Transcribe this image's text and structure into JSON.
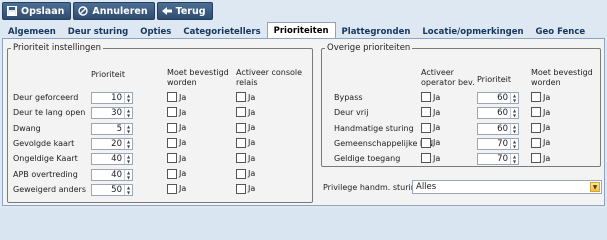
{
  "toolbar": {
    "save": {
      "label": "Opslaan",
      "icon": "save-icon"
    },
    "cancel": {
      "label": "Annuleren",
      "icon": "cancel-icon"
    },
    "back": {
      "label": "Terug",
      "icon": "back-arrow-icon"
    }
  },
  "tabs": [
    {
      "label": "Algemeen"
    },
    {
      "label": "Deur sturing"
    },
    {
      "label": "Opties"
    },
    {
      "label": "Categorietellers"
    },
    {
      "label": "Prioriteiten",
      "active": true
    },
    {
      "label": "Plattegronden"
    },
    {
      "label": "Locatie/opmerkingen"
    },
    {
      "label": "Geo Fence"
    }
  ],
  "left_group": {
    "legend": "Prioriteit instellingen",
    "headers": {
      "priority": "Prioriteit",
      "confirm": "Moet bevestigd worden",
      "console": "Activeer console relais"
    },
    "checkbox_label": "Ja",
    "rows": [
      {
        "label": "Deur geforceerd",
        "priority": "10"
      },
      {
        "label": "Deur te lang open",
        "priority": "30"
      },
      {
        "label": "Dwang",
        "priority": "5"
      },
      {
        "label": "Gevolgde kaart",
        "priority": "20"
      },
      {
        "label": "Ongeldige Kaart",
        "priority": "40"
      },
      {
        "label": "APB overtreding",
        "priority": "40"
      },
      {
        "label": "Geweigerd anders",
        "priority": "50"
      }
    ]
  },
  "right_group": {
    "legend": "Overige prioriteiten",
    "headers": {
      "operator": "Activeer operator bev.",
      "priority": "Prioriteit",
      "confirm": "Moet bevestigd worden"
    },
    "checkbox_label": "Ja",
    "rows": [
      {
        "label": "Bypass",
        "priority": "60"
      },
      {
        "label": "Deur vrij",
        "priority": "60"
      },
      {
        "label": "Handmatige sturing",
        "priority": "60"
      },
      {
        "label": "Gemeenschappelijke PIN",
        "priority": "70"
      },
      {
        "label": "Geldige toegang",
        "priority": "70"
      }
    ]
  },
  "privilege": {
    "label": "Privilege handm. sturing",
    "value": "Alles"
  }
}
